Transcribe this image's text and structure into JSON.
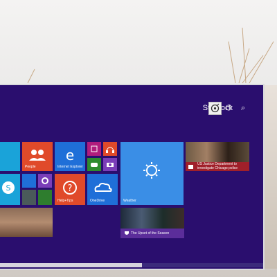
{
  "header": {
    "user_name": "Stardock",
    "power_icon": "power-icon",
    "search_icon": "search-icon"
  },
  "tiles": {
    "people": "People",
    "ie": "Internet Explorer",
    "help": "Help+Tips",
    "onedrive": "OneDrive",
    "weather": "Weather",
    "news_headline_1": "US Justice Department to",
    "news_headline_2": "investigate Chicago police",
    "sports_headline": "The Upset of the Season"
  },
  "colors": {
    "start_bg": "#2a0e6e",
    "orange": "#e04a2a",
    "blue": "#1f6fd8",
    "light_blue": "#3a8ee6",
    "magenta": "#b01c7d",
    "purple": "#7a3eb8",
    "green": "#2e8b2e",
    "news_red": "#a0202a",
    "sports_purple": "#5b2d9a",
    "cyan": "#1aa3d9"
  }
}
